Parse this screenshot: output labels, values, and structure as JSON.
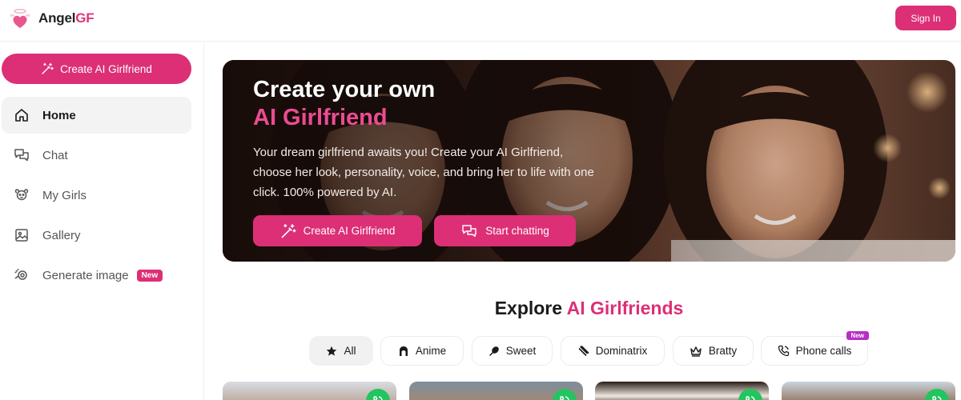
{
  "header": {
    "logo_text": "Angel",
    "logo_accent": "GF",
    "signin_label": "Sign In"
  },
  "sidebar": {
    "create_label": "Create AI Girlfriend",
    "items": [
      {
        "label": "Home",
        "icon": "home-icon",
        "active": true
      },
      {
        "label": "Chat",
        "icon": "chat-icon",
        "active": false
      },
      {
        "label": "My Girls",
        "icon": "my-girls-icon",
        "active": false
      },
      {
        "label": "Gallery",
        "icon": "gallery-icon",
        "active": false
      },
      {
        "label": "Generate image",
        "icon": "generate-image-icon",
        "active": false,
        "badge": "New"
      }
    ]
  },
  "hero": {
    "title_line1": "Create your own",
    "title_line2": "AI Girlfriend",
    "description": "Your dream girlfriend awaits you! Create your AI Girlfriend, choose her look, personality, voice, and bring her to life with one click. 100% powered by AI.",
    "primary_button": "Create AI Girlfriend",
    "secondary_button": "Start chatting"
  },
  "explore": {
    "title": "Explore",
    "title_accent": "AI Girlfriends",
    "filters": [
      {
        "label": "All",
        "icon": "star-icon",
        "active": true
      },
      {
        "label": "Anime",
        "icon": "anime-icon"
      },
      {
        "label": "Sweet",
        "icon": "sweet-icon"
      },
      {
        "label": "Dominatrix",
        "icon": "dominatrix-icon"
      },
      {
        "label": "Bratty",
        "icon": "crown-icon"
      },
      {
        "label": "Phone calls",
        "icon": "phone-icon",
        "badge": "New"
      }
    ]
  },
  "colors": {
    "brand": "#dc2f76",
    "call_green": "#22c55e",
    "new_badge_purple": "#b62fc2"
  }
}
